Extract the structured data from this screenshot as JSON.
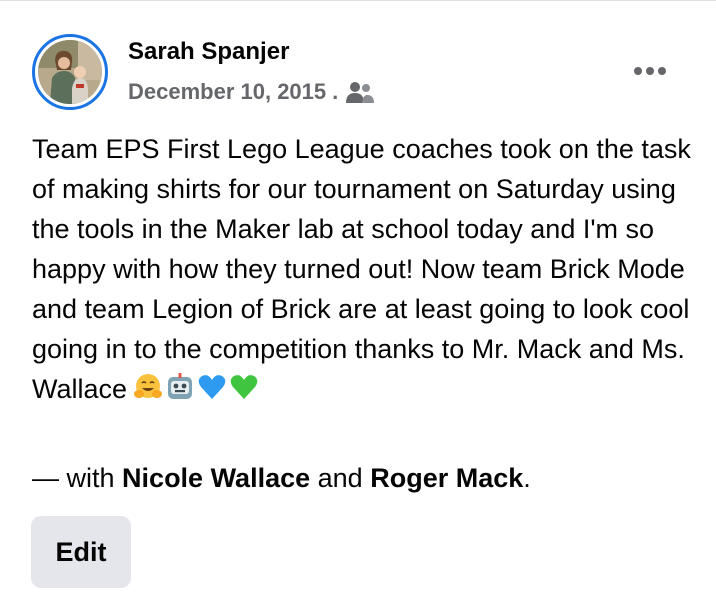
{
  "post": {
    "author": "Sarah Spanjer",
    "date": "December 10, 2015",
    "separator": ".",
    "audience_icon": "friends-icon",
    "more_icon": "more-options-icon",
    "body": "Team EPS First Lego League coaches took on the task of making shirts for our tournament on Saturday using the tools in the Maker lab at school today and I'm so happy with how they turned out! Now team Brick Mode and team Legion of Brick are at least going to look cool going in to the competition thanks to Mr. Mack and Ms. Wallace",
    "emojis": [
      "hugging-face-emoji",
      "robot-emoji",
      "blue-heart-emoji",
      "green-heart-emoji"
    ],
    "with_prefix": "— with",
    "tagged": [
      "Nicole Wallace",
      "Roger Mack"
    ],
    "with_and": "and",
    "with_suffix": ".",
    "edit_label": "Edit"
  },
  "colors": {
    "avatar_ring": "#1b74e4",
    "meta_text": "#65676b",
    "edit_bg": "#e4e6eb",
    "text": "#050505"
  }
}
